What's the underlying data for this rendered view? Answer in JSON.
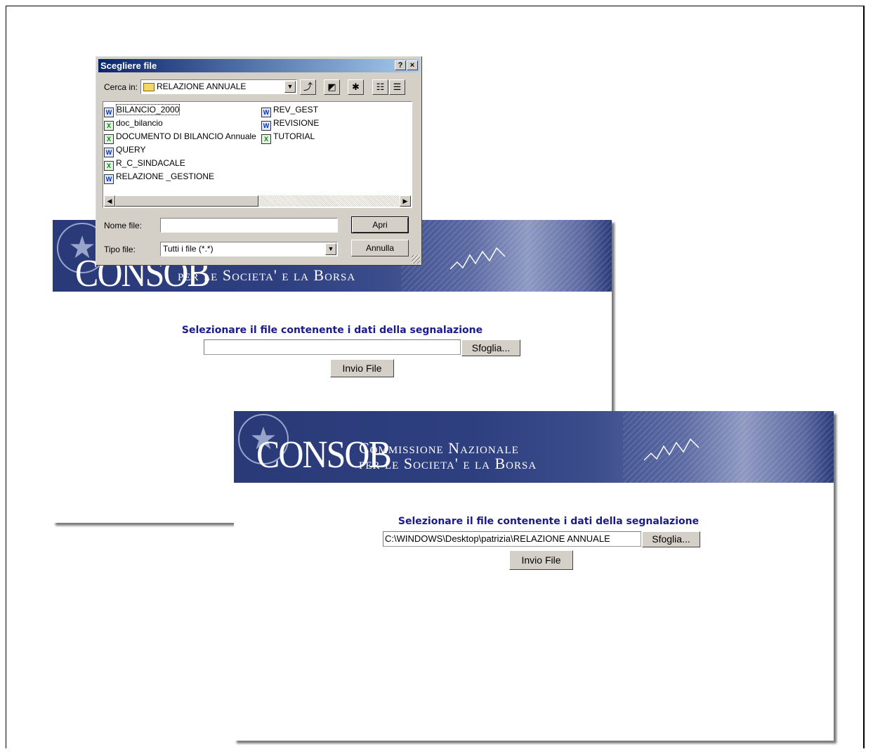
{
  "back_page": {
    "brand": "CONSOB",
    "tagline_line2": "per le Societa' e la Borsa",
    "prompt": "Selezionare il file contenente i dati della segnalazione",
    "file_value": "",
    "browse_label": "Sfoglia...",
    "submit_label": "Invio File"
  },
  "front_page": {
    "brand": "CONSOB",
    "tagline_line1": "Commissione Nazionale",
    "tagline_line2": "per le Societa' e la Borsa",
    "prompt": "Selezionare il file contenente i dati della segnalazione",
    "file_value": "C:\\WINDOWS\\Desktop\\patrizia\\RELAZIONE ANNUALE",
    "browse_label": "Sfoglia...",
    "submit_label": "Invio File"
  },
  "dialog": {
    "title": "Scegliere file",
    "help_button": "?",
    "close_button": "×",
    "look_in_label": "Cerca in:",
    "look_in_value": "RELAZIONE ANNUALE",
    "files": [
      {
        "name": "BILANCIO_2000",
        "type": "doc"
      },
      {
        "name": "doc_bilancio",
        "type": "xls"
      },
      {
        "name": "DOCUMENTO DI BILANCIO Annuale",
        "type": "xls"
      },
      {
        "name": "QUERY",
        "type": "doc"
      },
      {
        "name": "R_C_SINDACALE",
        "type": "xls"
      },
      {
        "name": "RELAZIONE _GESTIONE",
        "type": "doc"
      },
      {
        "name": "REV_GEST",
        "type": "doc"
      },
      {
        "name": "REVISIONE",
        "type": "doc"
      },
      {
        "name": "TUTORIAL",
        "type": "xls"
      }
    ],
    "filename_label": "Nome file:",
    "filename_value": "",
    "filetype_label": "Tipo file:",
    "filetype_value": "Tutti i file (*.*)",
    "open_button": "Apri",
    "cancel_button": "Annulla"
  }
}
